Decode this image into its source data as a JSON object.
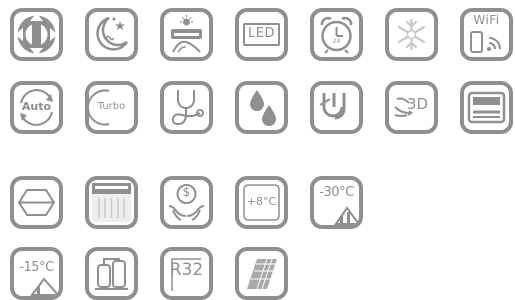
{
  "colors": {
    "icon": "#8f8f8f",
    "light": "#c9c9c9",
    "background": "#ffffff"
  },
  "icons": [
    {
      "name": "four-way-airflow-icon"
    },
    {
      "name": "sleep-mode-icon"
    },
    {
      "name": "self-cleaning-icon"
    },
    {
      "name": "led-display-icon",
      "label": "LED"
    },
    {
      "name": "timer-24h-icon",
      "label": "24"
    },
    {
      "name": "anti-freeze-icon"
    },
    {
      "name": "wifi-control-icon",
      "label": "WiFi"
    },
    {
      "name": "auto-mode-icon",
      "label": "Auto"
    },
    {
      "name": "turbo-mode-icon",
      "label": "Turbo"
    },
    {
      "name": "self-diagnosis-icon"
    },
    {
      "name": "dehumidify-icon"
    },
    {
      "name": "low-noise-icon"
    },
    {
      "name": "3d-airflow-icon",
      "label": "3D"
    },
    {
      "name": "indoor-unit-icon"
    },
    {
      "name": "hexagon-filter-icon"
    },
    {
      "name": "gold-fin-icon"
    },
    {
      "name": "energy-saving-icon",
      "label": "$"
    },
    {
      "name": "heating-8c-icon",
      "label": "+8°C"
    },
    {
      "name": "minus-30c-operation-icon",
      "label": "-30°C"
    },
    {
      "name": "minus-15c-operation-icon",
      "label": "-15°C"
    },
    {
      "name": "compressor-icon"
    },
    {
      "name": "r32-refrigerant-icon",
      "label": "R32"
    },
    {
      "name": "golden-fin-coating-icon"
    }
  ]
}
